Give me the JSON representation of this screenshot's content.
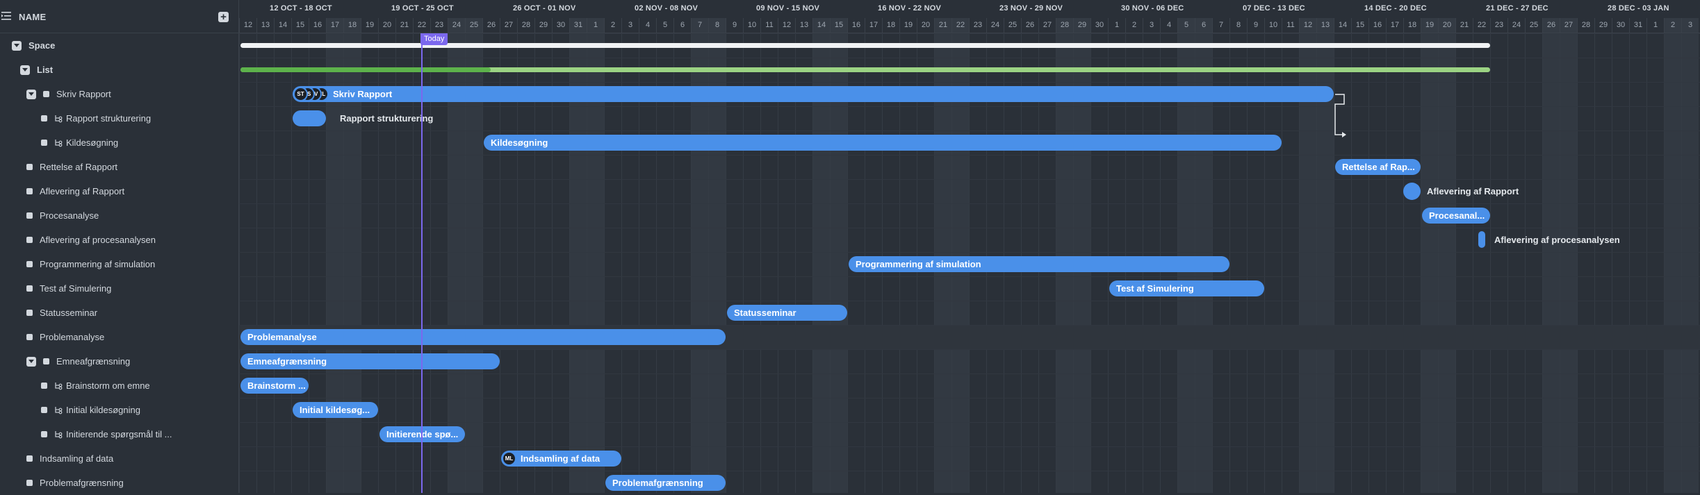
{
  "sidebar": {
    "header_label": "NAME",
    "rows": [
      {
        "label": "Space",
        "type": "toggle",
        "indent": 0,
        "bold": true
      },
      {
        "label": "List",
        "type": "toggle",
        "indent": 1,
        "bold": true
      },
      {
        "label": "Skriv Rapport",
        "type": "toggle-bullet",
        "indent": 2
      },
      {
        "label": "Rapport strukturering",
        "type": "subtask",
        "indent": 3
      },
      {
        "label": "Kildesøgning",
        "type": "subtask",
        "indent": 3
      },
      {
        "label": "Rettelse af Rapport",
        "type": "bullet",
        "indent": 2
      },
      {
        "label": "Aflevering af Rapport",
        "type": "bullet",
        "indent": 2
      },
      {
        "label": "Procesanalyse",
        "type": "bullet",
        "indent": 2
      },
      {
        "label": "Aflevering af procesanalysen",
        "type": "bullet",
        "indent": 2
      },
      {
        "label": "Programmering af simulation",
        "type": "bullet",
        "indent": 2
      },
      {
        "label": "Test af Simulering",
        "type": "bullet",
        "indent": 2
      },
      {
        "label": "Statusseminar",
        "type": "bullet",
        "indent": 2
      },
      {
        "label": "Problemanalyse",
        "type": "bullet",
        "indent": 2
      },
      {
        "label": "Emneafgrænsning",
        "type": "toggle-bullet",
        "indent": 2
      },
      {
        "label": "Brainstorm om emne",
        "type": "subtask",
        "indent": 3
      },
      {
        "label": "Initial kildesøgning",
        "type": "subtask",
        "indent": 3
      },
      {
        "label": "Initierende spørgsmål til ...",
        "type": "subtask",
        "indent": 3
      },
      {
        "label": "Indsamling af data",
        "type": "bullet",
        "indent": 2
      },
      {
        "label": "Problemafgrænsning",
        "type": "bullet",
        "indent": 2
      }
    ]
  },
  "timeline": {
    "weeks": [
      "12 OCT - 18 OCT",
      "19 OCT - 25 OCT",
      "26 OCT - 01 NOV",
      "02 NOV - 08 NOV",
      "09 NOV - 15 NOV",
      "16 NOV - 22 NOV",
      "23 NOV - 29 NOV",
      "30 NOV - 06 DEC",
      "07 DEC - 13 DEC",
      "14 DEC - 20 DEC",
      "21 DEC - 27 DEC",
      "28 DEC - 03 JAN"
    ],
    "days": [
      "12",
      "13",
      "14",
      "15",
      "16",
      "17",
      "18",
      "19",
      "20",
      "21",
      "22",
      "23",
      "24",
      "25",
      "26",
      "27",
      "28",
      "29",
      "30",
      "31",
      "1",
      "2",
      "3",
      "4",
      "5",
      "6",
      "7",
      "8",
      "9",
      "10",
      "11",
      "12",
      "13",
      "14",
      "15",
      "16",
      "17",
      "18",
      "19",
      "20",
      "21",
      "22",
      "23",
      "24",
      "25",
      "26",
      "27",
      "28",
      "29",
      "30",
      "1",
      "2",
      "3",
      "4",
      "5",
      "6",
      "7",
      "8",
      "9",
      "10",
      "11",
      "12",
      "13",
      "14",
      "15",
      "16",
      "17",
      "18",
      "19",
      "20",
      "21",
      "22",
      "23",
      "24",
      "25",
      "26",
      "27",
      "28",
      "29",
      "30",
      "31",
      "1",
      "2",
      "3"
    ],
    "today_label": "Today",
    "today_day_index": 10,
    "list_progress": 0.2,
    "bars": [
      {
        "row": 2,
        "start": 3,
        "end": 63,
        "label": "Skriv Rapport",
        "avatars": [
          "ST",
          "JS",
          "LV",
          "ML"
        ]
      },
      {
        "row": 3,
        "start": 3,
        "end": 5,
        "label": "",
        "outside_label": "Rapport strukturering"
      },
      {
        "row": 4,
        "start": 14,
        "end": 60,
        "label": "Kildesøgning"
      },
      {
        "row": 5,
        "start": 63,
        "end": 68,
        "label": "Rettelse af Rap..."
      },
      {
        "row": 7,
        "start": 68,
        "end": 72,
        "label": "Procesanal..."
      },
      {
        "row": 9,
        "start": 35,
        "end": 57,
        "label": "Programmering af simulation"
      },
      {
        "row": 10,
        "start": 50,
        "end": 59,
        "label": "Test af Simulering"
      },
      {
        "row": 11,
        "start": 28,
        "end": 35,
        "label": "Statusseminar"
      },
      {
        "row": 12,
        "start": 0,
        "end": 28,
        "label": "Problemanalyse"
      },
      {
        "row": 13,
        "start": 0,
        "end": 15,
        "label": "Emneafgrænsning"
      },
      {
        "row": 14,
        "start": 0,
        "end": 4,
        "label": "Brainstorm ..."
      },
      {
        "row": 15,
        "start": 3,
        "end": 8,
        "label": "Initial kildesøg..."
      },
      {
        "row": 16,
        "start": 8,
        "end": 13,
        "label": "Initierende spø..."
      },
      {
        "row": 17,
        "start": 15,
        "end": 22,
        "label": "Indsamling af data",
        "avatars": [
          "ML"
        ]
      },
      {
        "row": 18,
        "start": 21,
        "end": 28,
        "label": "Problemafgrænsning"
      }
    ],
    "milestones": [
      {
        "row": 6,
        "day": 67,
        "outside_label": "Aflevering af Rapport",
        "shape": "circle"
      },
      {
        "row": 8,
        "day": 71,
        "outside_label": "Aflevering af procesanalysen",
        "shape": "thin"
      }
    ]
  }
}
